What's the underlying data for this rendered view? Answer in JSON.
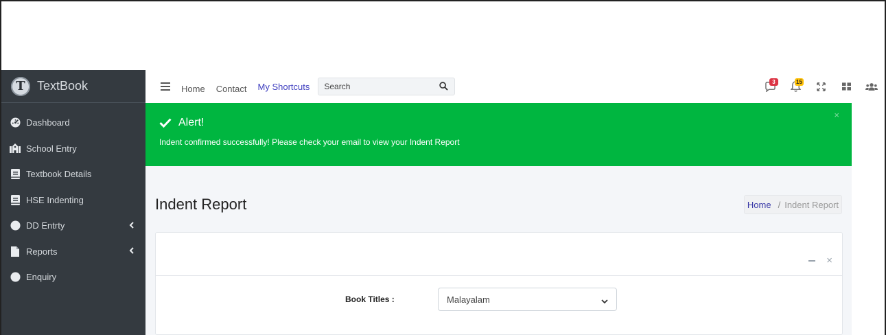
{
  "brand": {
    "name": "TextBook",
    "logo_letter": "T"
  },
  "sidebar": {
    "items": [
      {
        "label": "Dashboard",
        "icon": "dashboard-icon",
        "has_submenu": false
      },
      {
        "label": "School Entry",
        "icon": "school-icon",
        "has_submenu": false
      },
      {
        "label": "Textbook Details",
        "icon": "book-icon",
        "has_submenu": false
      },
      {
        "label": "HSE Indenting",
        "icon": "book-icon",
        "has_submenu": false
      },
      {
        "label": "DD Entrty",
        "icon": "circle-icon",
        "has_submenu": true
      },
      {
        "label": "Reports",
        "icon": "file-icon",
        "has_submenu": true
      },
      {
        "label": "Enquiry",
        "icon": "circle-icon",
        "has_submenu": false
      }
    ]
  },
  "navbar": {
    "home": "Home",
    "contact": "Contact",
    "shortcuts": "My Shortcuts",
    "search_placeholder": "Search",
    "messages_count": "3",
    "notifications_count": "15"
  },
  "alert": {
    "title": "Alert!",
    "message": "Indent confirmed successfully! Please check your email to view your Indent Report",
    "close": "×"
  },
  "page": {
    "title": "Indent Report",
    "breadcrumb": {
      "home": "Home",
      "separator": "/",
      "current": "Indent Report"
    }
  },
  "form": {
    "book_titles_label": "Book Titles :",
    "book_titles_value": "Malayalam"
  },
  "card": {
    "close": "×"
  },
  "colors": {
    "sidebar_bg": "#343a40",
    "alert_bg": "#00b640",
    "link_accent": "#4040c0",
    "badge_red": "#dc3545",
    "badge_yellow": "#ffc107"
  }
}
